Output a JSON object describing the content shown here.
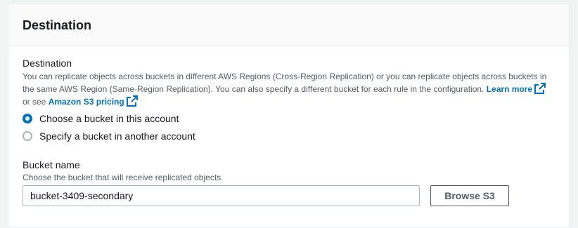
{
  "panel": {
    "title": "Destination"
  },
  "destination": {
    "label": "Destination",
    "description": "You can replicate objects across buckets in different AWS Regions (Cross-Region Replication) or you can replicate objects across buckets in the same AWS Region (Same-Region Replication). You can also specify a different bucket for each rule in the configuration.",
    "learn_more": "Learn more",
    "or_see": "or see",
    "pricing_link": "Amazon S3 pricing",
    "options": [
      {
        "label": "Choose a bucket in this account",
        "selected": true
      },
      {
        "label": "Specify a bucket in another account",
        "selected": false
      }
    ]
  },
  "bucket": {
    "label": "Bucket name",
    "description": "Choose the bucket that will receive replicated objects.",
    "value": "bucket-3409-secondary",
    "browse_label": "Browse S3"
  },
  "colors": {
    "link": "#0073bb",
    "radio_selected": "#0073bb",
    "text_primary": "#16191f",
    "text_secondary": "#545b64"
  },
  "icons": {
    "external_link": "external-link-icon"
  }
}
